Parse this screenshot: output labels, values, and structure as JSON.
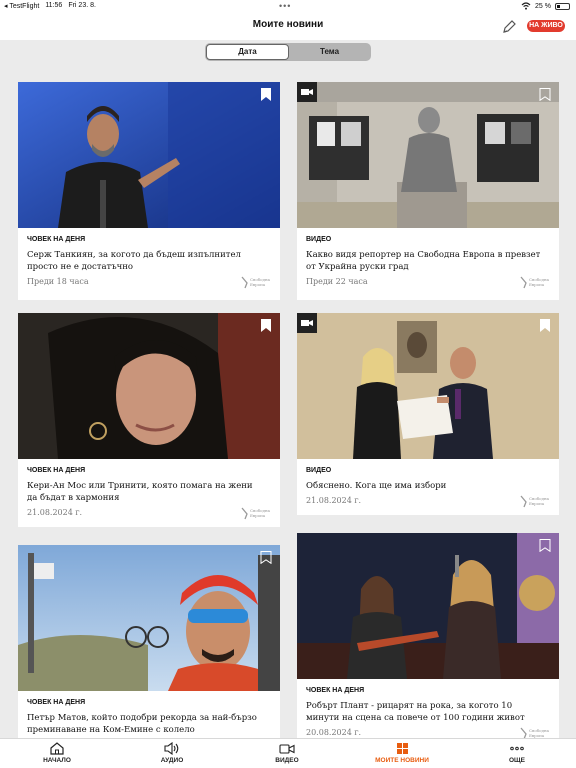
{
  "status": {
    "app": "TestFlight",
    "time": "11:56",
    "date": "Fri 23. 8.",
    "battery": "25 %",
    "battery_level": 0.25
  },
  "nav": {
    "title": "Моите новини",
    "live": "НА ЖИВО"
  },
  "segments": [
    "Дата",
    "Тема"
  ],
  "cards": [
    {
      "tag": "Човек на деня",
      "headline": "Серж Танкиян, за когото да бъдеш изпълнител просто не е достатъчно",
      "time": "Преди 18 часа"
    },
    {
      "tag": "Видео",
      "headline": "Какво видя репортер на Свободна Европа в превзет от Украйна руски град",
      "time": "Преди 22 часа"
    },
    {
      "tag": "Човек на деня",
      "headline": "Кери-Ан Мос или Тринити, която помага на жени да бъдат в хармония",
      "time": "21.08.2024 г."
    },
    {
      "tag": "Видео",
      "headline": "Обяснено. Кога ще има избори",
      "time": "21.08.2024 г."
    },
    {
      "tag": "Човек на деня",
      "headline": "Петър Матов, който подобри рекорда за най-бързо преминаване на Ком-Емине с колело",
      "time": ""
    },
    {
      "tag": "Човек на деня",
      "headline": "Робърт Плант - рицарят на рока, за когото 10 минути на сцена са повече от 100 години живот",
      "time": "20.08.2024 г."
    }
  ],
  "logo_text": "Свободна Европа",
  "tabs": [
    {
      "label": "НАЧАЛО",
      "icon": "home-icon"
    },
    {
      "label": "АУДИО",
      "icon": "speaker-icon"
    },
    {
      "label": "ВИДЕО",
      "icon": "video-camera-icon"
    },
    {
      "label": "МОИТЕ НОВИНИ",
      "icon": "grid-icon"
    },
    {
      "label": "ОЩЕ",
      "icon": "more-dots-icon"
    }
  ],
  "colors": {
    "accent": "#e85d10",
    "live": "#e23b2e",
    "background": "#ebebeb"
  }
}
